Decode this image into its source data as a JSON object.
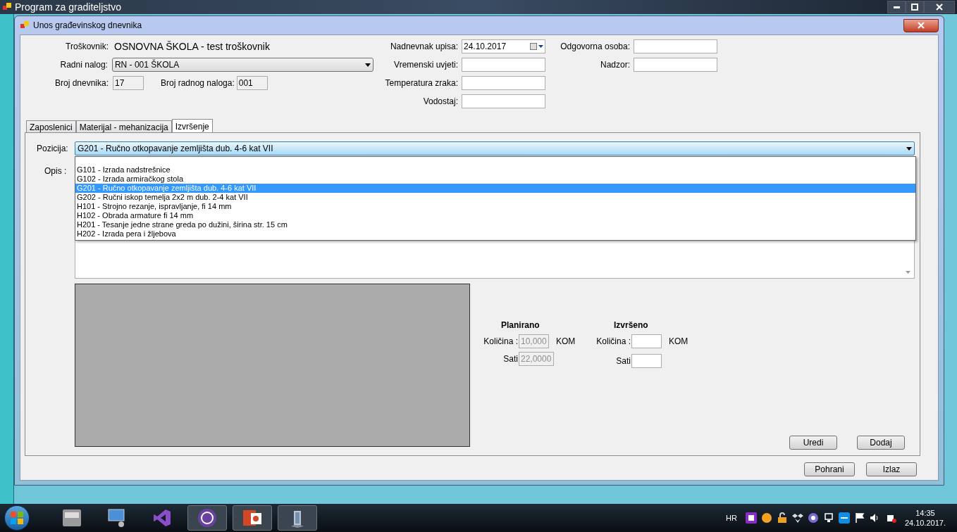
{
  "app_window": {
    "title": "Program za graditeljstvo"
  },
  "dialog": {
    "title": "Unos građevinskog dnevnika"
  },
  "header": {
    "troskovnik": {
      "label": "Troškovnik:",
      "value": "OSNOVNA ŠKOLA - test troškovnik"
    },
    "radni_nalog": {
      "label": "Radni nalog:",
      "value": "RN - 001 ŠKOLA"
    },
    "broj_dnevnika": {
      "label": "Broj dnevnika:",
      "value": "17"
    },
    "broj_radnog_naloga": {
      "label": "Broj radnog naloga:",
      "value": "001"
    },
    "middle_fields": [
      {
        "label": "Nadnevnak upisa:",
        "value": "24.10.2017",
        "kind": "date"
      },
      {
        "label": "Vremenski uvjeti:",
        "kind": "text"
      },
      {
        "label": "Temperatura zraka:",
        "kind": "text"
      },
      {
        "label": "Vodostaj:",
        "kind": "text"
      }
    ],
    "right_fields": [
      {
        "label": "Odgovorna osoba:"
      },
      {
        "label": "Nadzor:"
      }
    ]
  },
  "tabs": [
    {
      "label": "Zaposlenici",
      "selected": false
    },
    {
      "label": "Materijal - mehanizacija",
      "selected": false
    },
    {
      "label": "Izvršenje",
      "selected": true
    }
  ],
  "pozicija": {
    "label": "Pozicija:",
    "value": "G201 - Ručno otkopavanje zemljišta dub. 4-6 kat VII",
    "options": [
      {
        "label": "G101 - Izrada nadstrešnice",
        "selected": false
      },
      {
        "label": "G102 - Izrada armiračkog stola",
        "selected": false
      },
      {
        "label": "G201 - Ručno otkopavanje zemljišta dub. 4-6 kat VII",
        "selected": true
      },
      {
        "label": "G202 - Ručni iskop temelja 2x2 m dub. 2-4 kat VII",
        "selected": false
      },
      {
        "label": "H101 - Strojno rezanje, ispravljanje, fi 14 mm",
        "selected": false
      },
      {
        "label": "H102 - Obrada armature fi 14 mm",
        "selected": false
      },
      {
        "label": "H201 - Tesanje jedne strane greda po dužini, širina str. 15 cm",
        "selected": false
      },
      {
        "label": "H202 - Izrada pera i žljebova",
        "selected": false
      }
    ]
  },
  "opis": {
    "label": "Opis :"
  },
  "planirano": {
    "title": "Planirano",
    "kolicina_label": "Količina :",
    "kolicina": "10,000",
    "unit": "KOM",
    "sati_label": "Sati",
    "sati": "22,0000"
  },
  "izvrseno": {
    "title": "Izvršeno",
    "kolicina_label": "Količina :",
    "unit": "KOM",
    "sati_label": "Sati"
  },
  "panel_buttons": [
    "Uredi",
    "Dodaj"
  ],
  "dialog_buttons": [
    "Pohrani",
    "Izlaz"
  ],
  "taskbar": {
    "language": "HR",
    "time": "14:35",
    "date": "24.10.2017."
  }
}
